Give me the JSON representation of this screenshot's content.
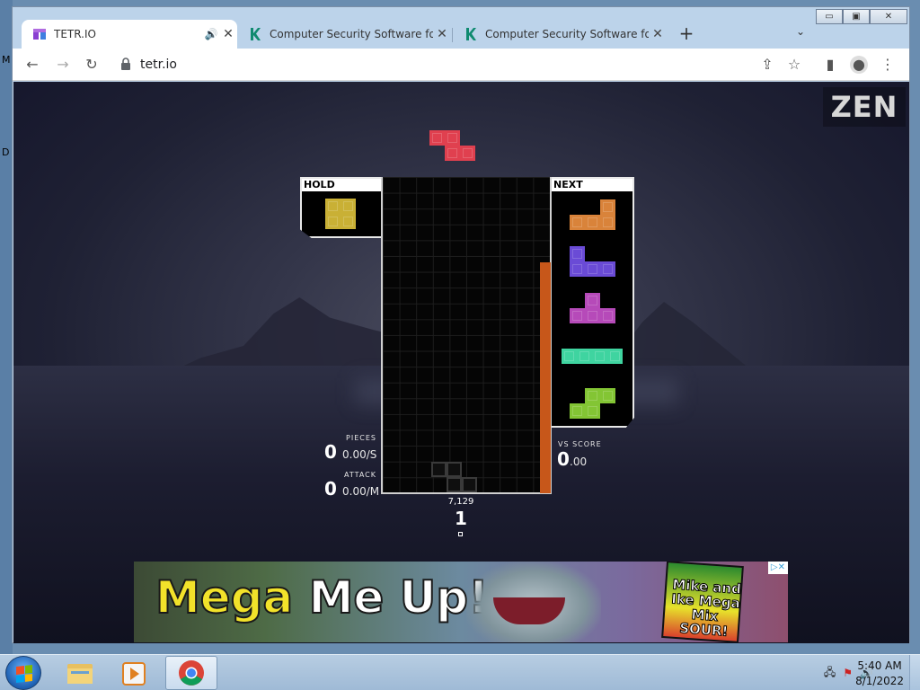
{
  "desktop": {
    "edge_labels": [
      "M",
      "D"
    ]
  },
  "browser": {
    "tabs": [
      {
        "title": "TETR.IO",
        "active": true,
        "audio": true,
        "favicon": "tetrio-icon"
      },
      {
        "title": "Computer Security Software for Home",
        "active": false,
        "favicon": "kaspersky-icon"
      },
      {
        "title": "Computer Security Software for Home",
        "active": false,
        "favicon": "kaspersky-icon"
      }
    ],
    "new_tab": "+",
    "address": "tetr.io",
    "window_controls": {
      "minimize": "▭",
      "maximize": "▣",
      "close": "✕"
    }
  },
  "game": {
    "mode_label": "ZEN",
    "hold_label": "HOLD",
    "next_label": "NEXT",
    "pieces_label": "PIECES",
    "pieces_value": "0",
    "pieces_rate": "0.00/S",
    "attack_label": "ATTACK",
    "attack_value": "0",
    "attack_rate": "0.00/M",
    "vs_score_label": "VS SCORE",
    "vs_score_value": "0",
    "vs_score_decimals": ".00",
    "level_progress": "7,129",
    "level": "1",
    "colors": {
      "hold_O": "#c9b035",
      "falling_Z": "#e0404f",
      "next_L": "#d9833a",
      "next_J": "#6a4bd6",
      "next_T": "#b64ab9",
      "next_I": "#3fd4a0",
      "next_S": "#83c534",
      "meter": "#c7571a"
    }
  },
  "ad": {
    "headline_1": "Mega",
    "headline_2": "Me Up!",
    "product": "Mike and Ike Mega Mix SOUR!",
    "ad_choices": "▷✕"
  },
  "taskbar": {
    "time": "5:40 AM",
    "date": "8/1/2022",
    "apps": [
      "explorer-icon",
      "media-player-icon",
      "chrome-icon"
    ]
  }
}
